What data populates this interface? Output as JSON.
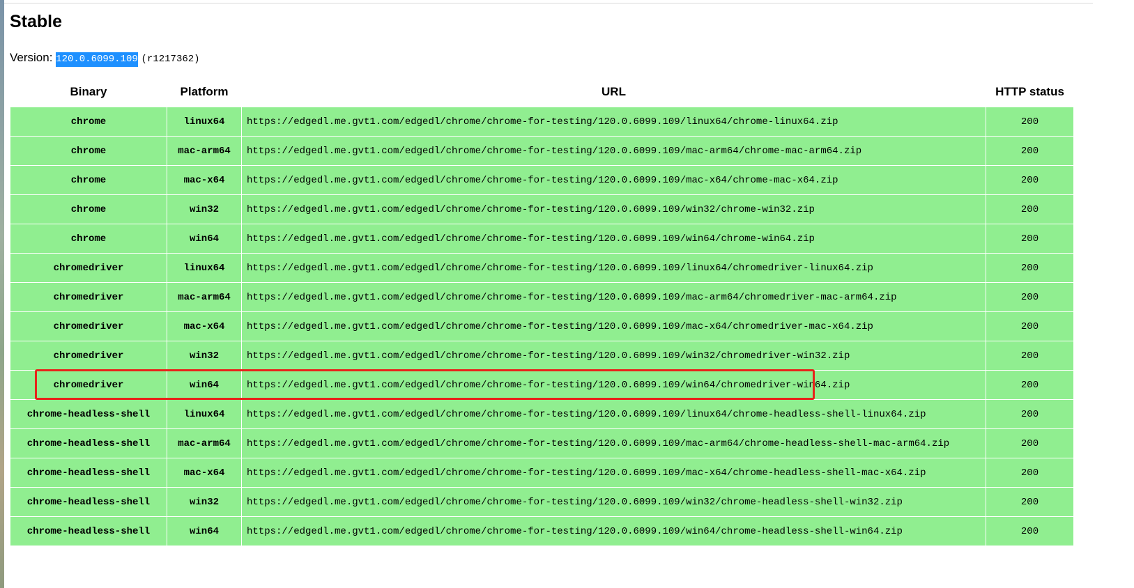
{
  "page": {
    "title": "Stable",
    "version_label": "Version:",
    "version_number": "120.0.6099.109",
    "revision": "(r1217362)"
  },
  "table": {
    "headers": [
      "Binary",
      "Platform",
      "URL",
      "HTTP status"
    ],
    "rows": [
      {
        "binary": "chrome",
        "platform": "linux64",
        "url": "https://edgedl.me.gvt1.com/edgedl/chrome/chrome-for-testing/120.0.6099.109/linux64/chrome-linux64.zip",
        "status": "200"
      },
      {
        "binary": "chrome",
        "platform": "mac-arm64",
        "url": "https://edgedl.me.gvt1.com/edgedl/chrome/chrome-for-testing/120.0.6099.109/mac-arm64/chrome-mac-arm64.zip",
        "status": "200"
      },
      {
        "binary": "chrome",
        "platform": "mac-x64",
        "url": "https://edgedl.me.gvt1.com/edgedl/chrome/chrome-for-testing/120.0.6099.109/mac-x64/chrome-mac-x64.zip",
        "status": "200"
      },
      {
        "binary": "chrome",
        "platform": "win32",
        "url": "https://edgedl.me.gvt1.com/edgedl/chrome/chrome-for-testing/120.0.6099.109/win32/chrome-win32.zip",
        "status": "200"
      },
      {
        "binary": "chrome",
        "platform": "win64",
        "url": "https://edgedl.me.gvt1.com/edgedl/chrome/chrome-for-testing/120.0.6099.109/win64/chrome-win64.zip",
        "status": "200"
      },
      {
        "binary": "chromedriver",
        "platform": "linux64",
        "url": "https://edgedl.me.gvt1.com/edgedl/chrome/chrome-for-testing/120.0.6099.109/linux64/chromedriver-linux64.zip",
        "status": "200"
      },
      {
        "binary": "chromedriver",
        "platform": "mac-arm64",
        "url": "https://edgedl.me.gvt1.com/edgedl/chrome/chrome-for-testing/120.0.6099.109/mac-arm64/chromedriver-mac-arm64.zip",
        "status": "200"
      },
      {
        "binary": "chromedriver",
        "platform": "mac-x64",
        "url": "https://edgedl.me.gvt1.com/edgedl/chrome/chrome-for-testing/120.0.6099.109/mac-x64/chromedriver-mac-x64.zip",
        "status": "200"
      },
      {
        "binary": "chromedriver",
        "platform": "win32",
        "url": "https://edgedl.me.gvt1.com/edgedl/chrome/chrome-for-testing/120.0.6099.109/win32/chromedriver-win32.zip",
        "status": "200"
      },
      {
        "binary": "chromedriver",
        "platform": "win64",
        "url": "https://edgedl.me.gvt1.com/edgedl/chrome/chrome-for-testing/120.0.6099.109/win64/chromedriver-win64.zip",
        "status": "200"
      },
      {
        "binary": "chrome-headless-shell",
        "platform": "linux64",
        "url": "https://edgedl.me.gvt1.com/edgedl/chrome/chrome-for-testing/120.0.6099.109/linux64/chrome-headless-shell-linux64.zip",
        "status": "200"
      },
      {
        "binary": "chrome-headless-shell",
        "platform": "mac-arm64",
        "url": "https://edgedl.me.gvt1.com/edgedl/chrome/chrome-for-testing/120.0.6099.109/mac-arm64/chrome-headless-shell-mac-arm64.zip",
        "status": "200"
      },
      {
        "binary": "chrome-headless-shell",
        "platform": "mac-x64",
        "url": "https://edgedl.me.gvt1.com/edgedl/chrome/chrome-for-testing/120.0.6099.109/mac-x64/chrome-headless-shell-mac-x64.zip",
        "status": "200"
      },
      {
        "binary": "chrome-headless-shell",
        "platform": "win32",
        "url": "https://edgedl.me.gvt1.com/edgedl/chrome/chrome-for-testing/120.0.6099.109/win32/chrome-headless-shell-win32.zip",
        "status": "200"
      },
      {
        "binary": "chrome-headless-shell",
        "platform": "win64",
        "url": "https://edgedl.me.gvt1.com/edgedl/chrome/chrome-for-testing/120.0.6099.109/win64/chrome-headless-shell-win64.zip",
        "status": "200"
      }
    ]
  },
  "colors": {
    "row_ok": "#90ee90",
    "selection": "#1e90ff",
    "annotation_box": "#e8231a"
  }
}
